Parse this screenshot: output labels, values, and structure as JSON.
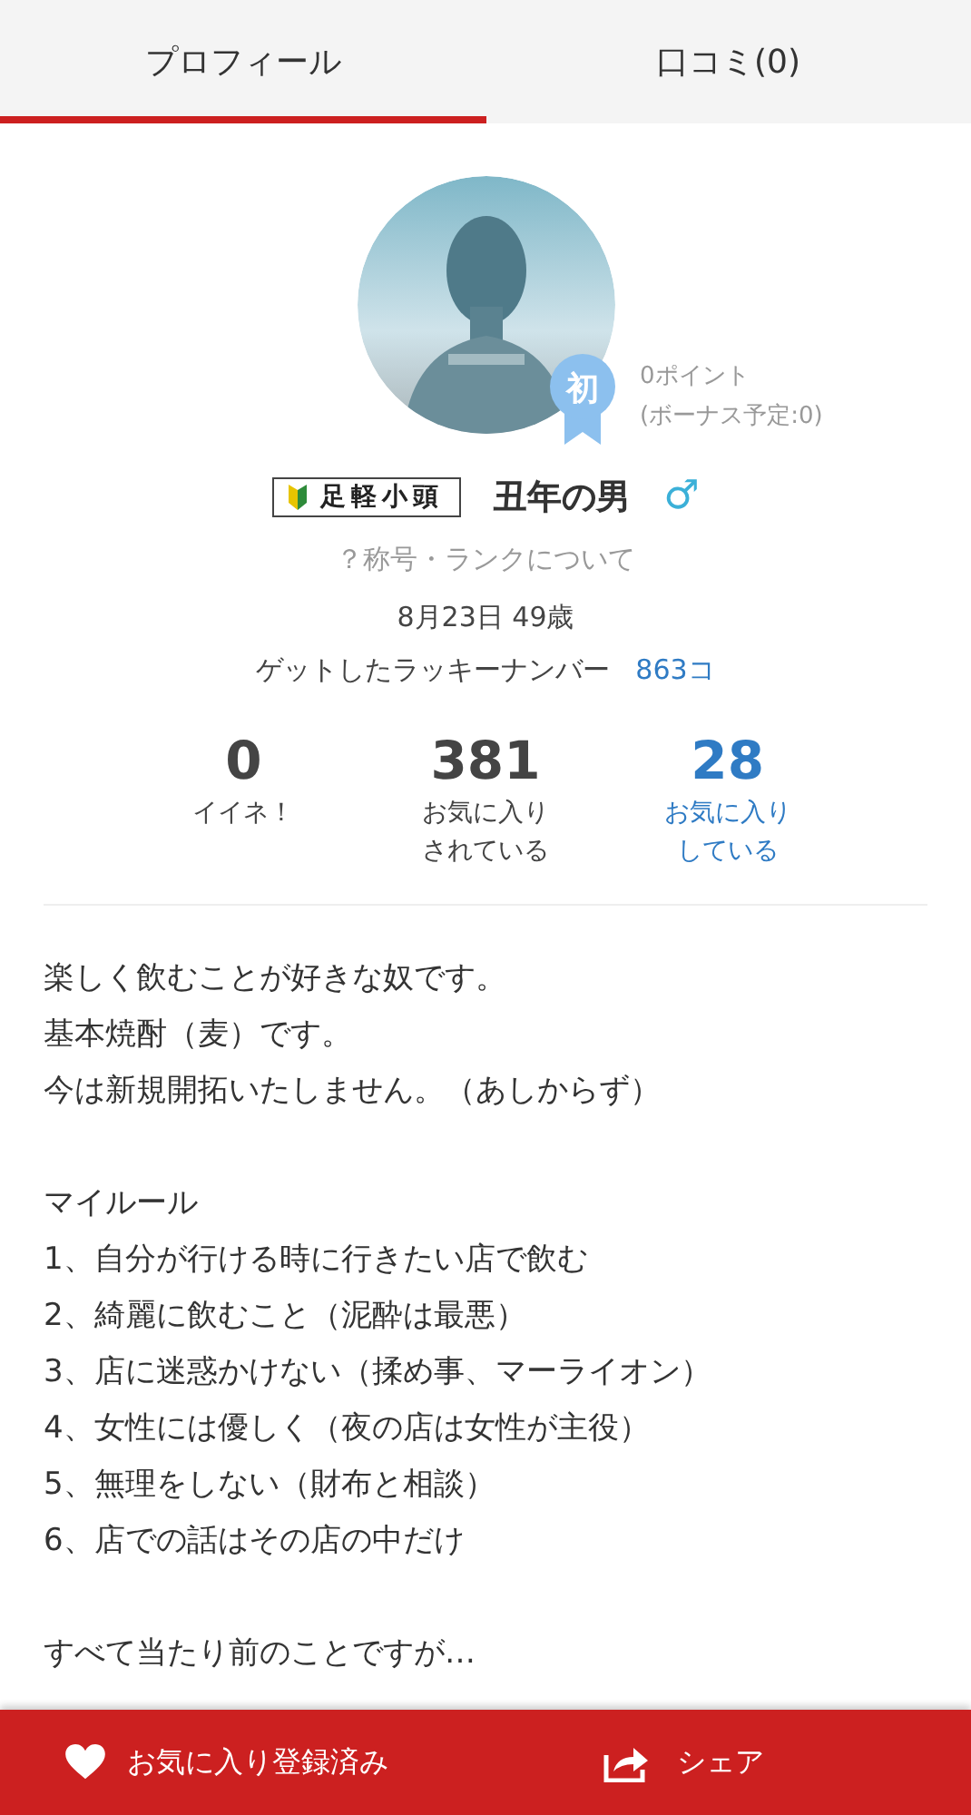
{
  "tabs": [
    {
      "label": "プロフィール",
      "selected": true
    },
    {
      "label": "口コミ(0)",
      "selected": false
    }
  ],
  "profile": {
    "badge": "初",
    "points": "0ポイント",
    "bonus": "(ボーナス予定:0)",
    "rank_title": "足軽小頭",
    "name": "丑年の男",
    "gender_symbol": "♂",
    "rank_link": "？称号・ランクについて",
    "birthday_age": "8月23日 49歳",
    "lucky_label": "ゲットしたラッキーナンバー",
    "lucky_count": "863コ"
  },
  "stats": [
    {
      "kind": "count",
      "value": "0",
      "label": [
        "イイネ！"
      ]
    },
    {
      "kind": "count",
      "value": "381",
      "label": [
        "お気に入り",
        "されている"
      ]
    },
    {
      "kind": "link",
      "value": "28",
      "label": [
        "お気に入り",
        "している"
      ]
    }
  ],
  "bio": [
    [
      "楽しく飲むことが好きな奴です。",
      "基本焼酎（麦）です。",
      "今は新規開拓いたしません。（あしからず）"
    ],
    [
      "マイルール",
      "1、自分が行ける時に行きたい店で飲む",
      "2、綺麗に飲むこと（泥酔は最悪）",
      "3、店に迷惑かけない（揉め事、マーライオン）",
      "4、女性には優しく（夜の店は女性が主役）",
      "5、無理をしない（財布と相談）",
      "6、店での話はその店の中だけ"
    ],
    [
      "すべて当たり前のことですが…"
    ]
  ],
  "footer": {
    "favorite": "お気に入り登録済み",
    "share": "シェア"
  }
}
